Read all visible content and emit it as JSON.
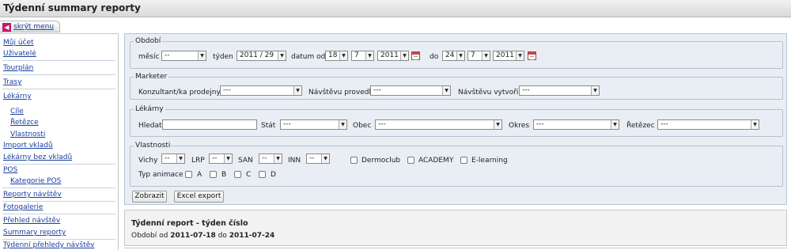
{
  "page": {
    "title": "Týdenní summary reporty"
  },
  "hide_menu": {
    "label": "skrýt menu"
  },
  "sidebar": {
    "items": [
      {
        "label": "Můj účet"
      },
      {
        "label": "Uživatelé"
      },
      {
        "label": "Tourplán"
      },
      {
        "label": "Trasy"
      },
      {
        "label": "Lékárny"
      },
      {
        "label": "Cíle"
      },
      {
        "label": "Řetězce"
      },
      {
        "label": "Vlastnosti"
      },
      {
        "label": "Import vkladů"
      },
      {
        "label": "Lékárny bez vkladů"
      },
      {
        "label": "POS"
      },
      {
        "label": "Kategorie POS"
      },
      {
        "label": "Reporty návštěv"
      },
      {
        "label": "Fotogalerie"
      },
      {
        "label": "Přehled návštěv"
      },
      {
        "label": "Summary reporty"
      },
      {
        "label": "Týdenní přehledy návštěv"
      }
    ]
  },
  "filters": {
    "period": {
      "legend": "Období",
      "month_label": "měsíc",
      "month_value": "--",
      "week_label": "týden",
      "week_value": "2011 / 29",
      "date_from_label": "datum od",
      "from_day": "18",
      "from_month": "7",
      "from_year": "2011",
      "to_label": "do",
      "to_day": "24",
      "to_month": "7",
      "to_year": "2011"
    },
    "marketer": {
      "legend": "Marketer",
      "consultant_label": "Konzultant/ka prodejny",
      "consultant_value": "---",
      "visit_done_label": "Návštěvu provedl",
      "visit_done_value": "---",
      "visit_created_label": "Návštěvu vytvořil",
      "visit_created_value": "---"
    },
    "pharmacies": {
      "legend": "Lékárny",
      "search_label": "Hledat",
      "search_value": "",
      "state_label": "Stát",
      "state_value": "---",
      "municipality_label": "Obec",
      "municipality_value": "---",
      "district_label": "Okres",
      "district_value": "---",
      "chain_label": "Řetězec",
      "chain_value": "---"
    },
    "properties": {
      "legend": "Vlastnosti",
      "vichy_label": "Vichy",
      "vichy_value": "--",
      "lrp_label": "LRP",
      "lrp_value": "--",
      "san_label": "SAN",
      "san_value": "--",
      "inn_label": "INN",
      "inn_value": "--",
      "dermoclub_label": "Dermoclub",
      "academy_label": "ACADEMY",
      "elearning_label": "E-learning",
      "animation_label": "Typ animace",
      "animation_a": "A",
      "animation_b": "B",
      "animation_c": "C",
      "animation_d": "D"
    },
    "buttons": {
      "show": "Zobrazit",
      "excel": "Excel export"
    }
  },
  "report": {
    "title": "Týdenní report - týden číslo",
    "period_prefix": "Období od",
    "period_from": "2011-07-18",
    "period_mid": "do",
    "period_to": "2011-07-24"
  },
  "colors": {
    "link": "#1a3fa0",
    "panel_bg": "#e9eef5",
    "calendar_icon": "#c84a4a",
    "hide_menu_icon": "#c2186a"
  }
}
